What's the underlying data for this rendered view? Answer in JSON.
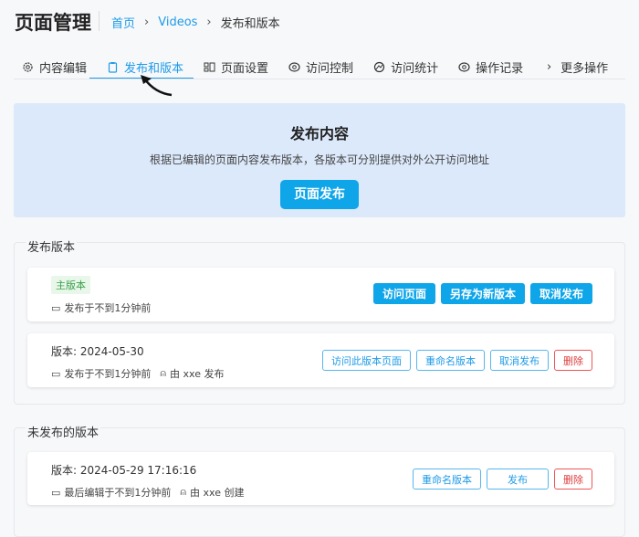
{
  "header": {
    "title": "页面管理",
    "breadcrumb": [
      "首页",
      "Videos",
      "发布和版本"
    ]
  },
  "tabs": [
    {
      "label": "内容编辑",
      "icon": "gear-icon"
    },
    {
      "label": "发布和版本",
      "icon": "clipboard-icon",
      "active": true
    },
    {
      "label": "页面设置",
      "icon": "layout-icon"
    },
    {
      "label": "访问控制",
      "icon": "eye-icon"
    },
    {
      "label": "访问统计",
      "icon": "chart-icon"
    },
    {
      "label": "操作记录",
      "icon": "eye-icon"
    },
    {
      "label": "更多操作",
      "icon": "chevron-right-icon"
    }
  ],
  "banner": {
    "title": "发布内容",
    "description": "根据已编辑的页面内容发布版本，各版本可分别提供对外公开访问地址",
    "button": "页面发布"
  },
  "published": {
    "legend": "发布版本",
    "main": {
      "badge": "主版本",
      "time": "发布于不到1分钟前",
      "buttons": [
        "访问页面",
        "另存为新版本",
        "取消发布"
      ]
    },
    "versions": [
      {
        "title": "版本: 2024-05-30",
        "time": "发布于不到1分钟前",
        "author": "由 xxe 发布",
        "buttons": [
          "访问此版本页面",
          "重命名版本",
          "取消发布"
        ],
        "delete": "删除"
      }
    ]
  },
  "unpublished": {
    "legend": "未发布的版本",
    "versions": [
      {
        "title": "版本: 2024-05-29 17:16:16",
        "time": "最后编辑于不到1分钟前",
        "author": "由 xxe 创建",
        "buttons": [
          "重命名版本",
          "发布"
        ],
        "delete": "删除"
      }
    ]
  },
  "colors": {
    "accent": "#0ea5e9",
    "danger": "#e03e3e",
    "banner": "#dce9fb"
  }
}
